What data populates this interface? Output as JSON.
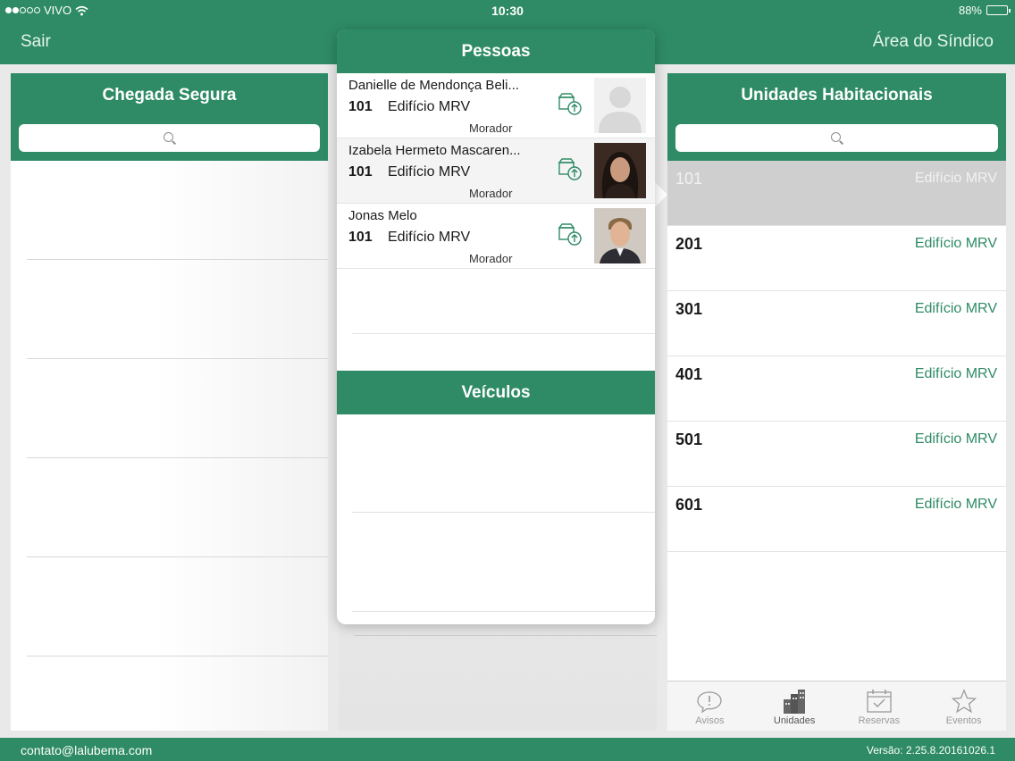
{
  "status": {
    "carrier": "VIVO",
    "time": "10:30",
    "battery": "88%",
    "battery_level": 0.88
  },
  "nav": {
    "left": "Sair",
    "right": "Área do Síndico"
  },
  "left_panel": {
    "title": "Chegada Segura",
    "search_placeholder": ""
  },
  "people_popover": {
    "title": "Pessoas",
    "people": [
      {
        "name": "Danielle de Mendonça Beli...",
        "unit": "101",
        "building": "Edifício MRV",
        "role": "Morador",
        "photo": "placeholder-silhouette"
      },
      {
        "name": "Izabela Hermeto Mascaren...",
        "unit": "101",
        "building": "Edifício MRV",
        "role": "Morador",
        "photo": "woman-photo"
      },
      {
        "name": "Jonas Melo",
        "unit": "101",
        "building": "Edifício MRV",
        "role": "Morador",
        "photo": "man-photo"
      }
    ],
    "vehicles_title": "Veículos"
  },
  "right_panel": {
    "title": "Unidades Habitacionais",
    "units": [
      {
        "number": "101",
        "building": "Edifício MRV",
        "selected": true
      },
      {
        "number": "201",
        "building": "Edifício MRV"
      },
      {
        "number": "301",
        "building": "Edifício MRV"
      },
      {
        "number": "401",
        "building": "Edifício MRV"
      },
      {
        "number": "501",
        "building": "Edifício MRV"
      },
      {
        "number": "601",
        "building": "Edifício MRV"
      }
    ],
    "tabs": [
      {
        "label": "Avisos",
        "icon": "speech-bubble-icon"
      },
      {
        "label": "Unidades",
        "icon": "buildings-icon",
        "active": true
      },
      {
        "label": "Reservas",
        "icon": "calendar-icon"
      },
      {
        "label": "Eventos",
        "icon": "star-icon"
      }
    ]
  },
  "footer": {
    "email": "contato@lalubema.com",
    "version": "Versão: 2.25.8.20161026.1"
  },
  "colors": {
    "brand_green": "#2e8b65",
    "selected_row": "#cfcfcf"
  }
}
